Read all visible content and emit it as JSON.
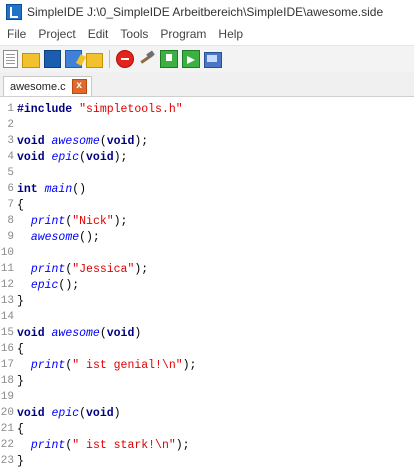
{
  "window": {
    "title": "SimpleIDE J:\\0_SimpleIDE Arbeitbereich\\SimpleIDE\\awesome.side"
  },
  "menu": [
    "File",
    "Project",
    "Edit",
    "Tools",
    "Program",
    "Help"
  ],
  "toolbar": {
    "icons": [
      "new-file-icon",
      "open-folder-icon",
      "save-icon",
      "save-as-icon",
      "open-project-icon",
      "stop-icon",
      "build-icon",
      "load-ram-icon",
      "run-icon",
      "terminal-icon"
    ]
  },
  "tab": {
    "label": "awesome.c",
    "close": "x"
  },
  "editor": {
    "lines": [
      {
        "n": "1",
        "code": "#include \"simpletools.h\""
      },
      {
        "n": "2",
        "code": ""
      },
      {
        "n": "3",
        "code": "void awesome(void);"
      },
      {
        "n": "4",
        "code": "void epic(void);"
      },
      {
        "n": "5",
        "code": ""
      },
      {
        "n": "6",
        "code": "int main()"
      },
      {
        "n": "7",
        "code": "{"
      },
      {
        "n": "8",
        "code": "  print(\"Nick\");"
      },
      {
        "n": "9",
        "code": "  awesome();"
      },
      {
        "n": "10",
        "code": ""
      },
      {
        "n": "11",
        "code": "  print(\"Jessica\");"
      },
      {
        "n": "12",
        "code": "  epic();"
      },
      {
        "n": "13",
        "code": "}"
      },
      {
        "n": "14",
        "code": ""
      },
      {
        "n": "15",
        "code": "void awesome(void)"
      },
      {
        "n": "16",
        "code": "{"
      },
      {
        "n": "17",
        "code": "  print(\" ist genial!\\n\");"
      },
      {
        "n": "18",
        "code": "}"
      },
      {
        "n": "19",
        "code": ""
      },
      {
        "n": "20",
        "code": "void epic(void)"
      },
      {
        "n": "21",
        "code": "{"
      },
      {
        "n": "22",
        "code": "  print(\" ist stark!\\n\");"
      },
      {
        "n": "23",
        "code": "}"
      }
    ]
  },
  "colors": {
    "keyword": "#000080",
    "string": "#e00000",
    "function": "#0000ff",
    "line_number": "#8a8a8a"
  }
}
